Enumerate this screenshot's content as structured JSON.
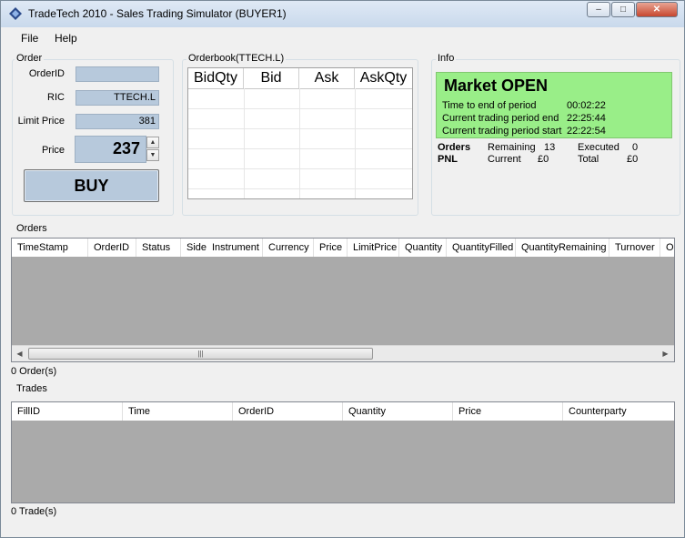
{
  "window": {
    "title": "TradeTech 2010 - Sales Trading Simulator (BUYER1)",
    "minimize_glyph": "–",
    "maximize_glyph": "□",
    "close_glyph": "✕"
  },
  "menu": {
    "file": "File",
    "help": "Help"
  },
  "order": {
    "group_label": "Order",
    "order_id_label": "OrderID",
    "order_id_value": "",
    "ric_label": "RIC",
    "ric_value": "TTECH.L",
    "limit_price_label": "Limit Price",
    "limit_price_value": "381",
    "price_label": "Price",
    "price_value": "237",
    "buy_label": "BUY"
  },
  "orderbook": {
    "group_label": "Orderbook(TTECH.L)",
    "columns": [
      "BidQty",
      "Bid",
      "Ask",
      "AskQty"
    ]
  },
  "info": {
    "group_label": "Info",
    "market_status": "Market OPEN",
    "rows": [
      {
        "label": "Time to end of period",
        "value": "00:02:22"
      },
      {
        "label": "Current trading period end",
        "value": "22:25:44"
      },
      {
        "label": "Current trading period start",
        "value": "22:22:54"
      }
    ],
    "orders_label": "Orders",
    "remaining_label": "Remaining",
    "remaining_value": "13",
    "executed_label": "Executed",
    "executed_value": "0",
    "pnl_label": "PNL",
    "current_label": "Current",
    "current_value": "£0",
    "total_label": "Total",
    "total_value": "£0",
    "panel_color": "#99ee88"
  },
  "orders_table": {
    "label": "Orders",
    "columns": [
      "TimeStamp",
      "OrderID",
      "Status",
      "Side",
      "Instrument",
      "Currency",
      "Price",
      "LimitPrice",
      "Quantity",
      "QuantityFilled",
      "QuantityRemaining",
      "Turnover",
      "Or"
    ],
    "count": "0 Order(s)"
  },
  "trades_table": {
    "label": "Trades",
    "columns": [
      "FillID",
      "Time",
      "OrderID",
      "Quantity",
      "Price",
      "Counterparty"
    ],
    "count": "0 Trade(s)"
  }
}
